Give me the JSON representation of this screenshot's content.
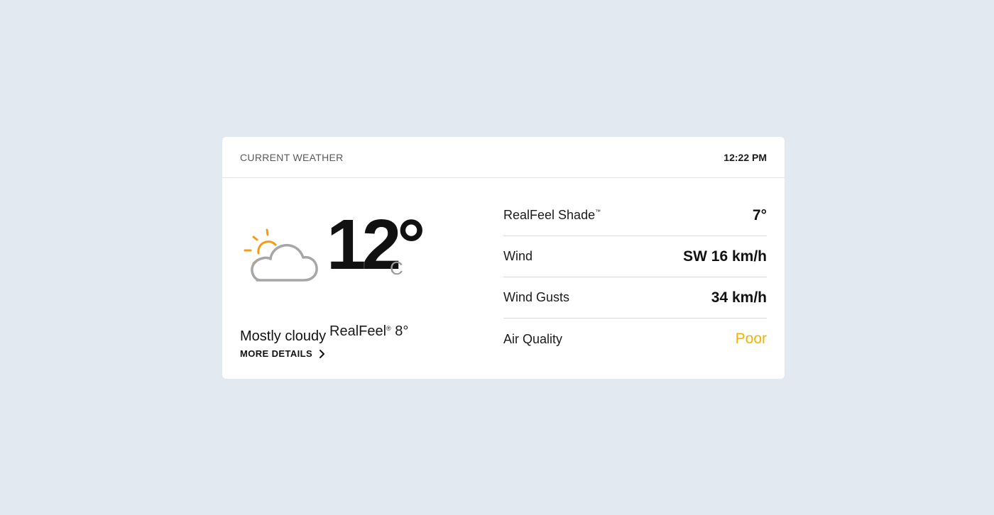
{
  "header": {
    "title": "CURRENT WEATHER",
    "time": "12:22 PM"
  },
  "current": {
    "icon": "partly-cloudy-icon",
    "temperature": "12°",
    "unit": "C",
    "realfeel_label": "RealFeel",
    "realfeel_mark": "®",
    "realfeel_value": "8°",
    "phrase": "Mostly cloudy",
    "more_details_label": "MORE DETAILS"
  },
  "details": [
    {
      "label": "RealFeel Shade",
      "mark": "™",
      "value": "7°"
    },
    {
      "label": "Wind",
      "mark": "",
      "value": "SW 16 km/h"
    },
    {
      "label": "Wind Gusts",
      "mark": "",
      "value": "34 km/h"
    },
    {
      "label": "Air Quality",
      "mark": "",
      "value": "Poor"
    }
  ],
  "colors": {
    "sun": "#f39c12",
    "cloud_outline": "#a6a6a6",
    "air_quality_poor": "#f0b400",
    "background": "#e2e9f1"
  }
}
